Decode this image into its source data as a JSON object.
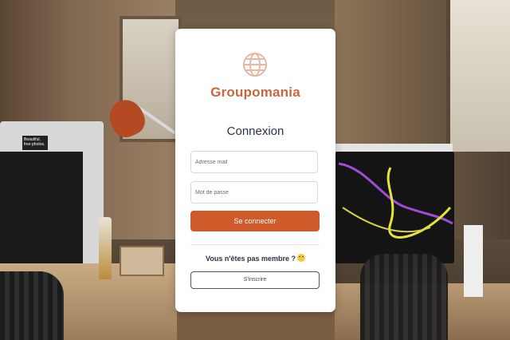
{
  "brand": {
    "name": "Groupomania",
    "logo_icon": "globe-icon",
    "accent_color": "#c8663f"
  },
  "form": {
    "title": "Connexion",
    "email_placeholder": "Adresse mail",
    "password_placeholder": "Mot de passe",
    "submit_label": "Se connecter",
    "submit_color": "#cf5a2a"
  },
  "signup": {
    "prompt": "Vous n'êtes pas membre ?",
    "emoji_icon": "sad-face-emoji-icon",
    "button_label": "S'inscrire"
  },
  "background": {
    "sticker_text": "Beautiful, free photos."
  }
}
